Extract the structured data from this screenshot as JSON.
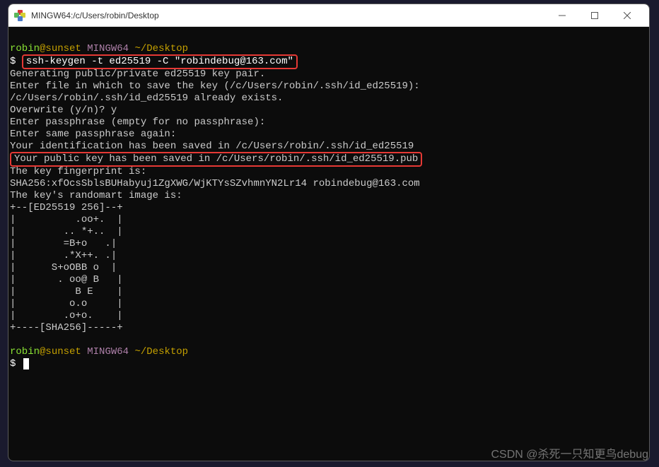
{
  "titlebar": {
    "title": "MINGW64:/c/Users/robin/Desktop"
  },
  "prompt1": {
    "user": "robin",
    "at": "@",
    "host": "sunset",
    "mingw": " MINGW64 ",
    "path": "~/Desktop",
    "dollar": "$ ",
    "command": "ssh-keygen -t ed25519 -C \"robindebug@163.com\""
  },
  "out": {
    "l1": "Generating public/private ed25519 key pair.",
    "l2": "Enter file in which to save the key (/c/Users/robin/.ssh/id_ed25519):",
    "l3": "/c/Users/robin/.ssh/id_ed25519 already exists.",
    "l4": "Overwrite (y/n)? y",
    "l5": "Enter passphrase (empty for no passphrase):",
    "l6": "Enter same passphrase again:",
    "l7": "Your identification has been saved in /c/Users/robin/.ssh/id_ed25519",
    "l8": "Your public key has been saved in /c/Users/robin/.ssh/id_ed25519.pub",
    "l9": "The key fingerprint is:",
    "l10": "SHA256:xfOcsSblsBUHabyuj1ZgXWG/WjKTYsSZvhmnYN2Lr14 robindebug@163.com",
    "l11": "The key's randomart image is:",
    "art01": "+--[ED25519 256]--+",
    "art02": "|          .oo+.  |",
    "art03": "|        .. *+..  |",
    "art04": "|        =B+o   .|",
    "art05": "|        .*X++. .|",
    "art06": "|      S+oOBB o  |",
    "art07": "|       . oo@ B   |",
    "art08": "|          B E    |",
    "art09": "|         o.o     |",
    "art10": "|        .o+o.    |",
    "art11": "+----[SHA256]-----+"
  },
  "prompt2": {
    "user": "robin",
    "at": "@",
    "host": "sunset",
    "mingw": " MINGW64 ",
    "path": "~/Desktop",
    "dollar": "$ "
  },
  "watermark": "CSDN @杀死一只知更鸟debug"
}
